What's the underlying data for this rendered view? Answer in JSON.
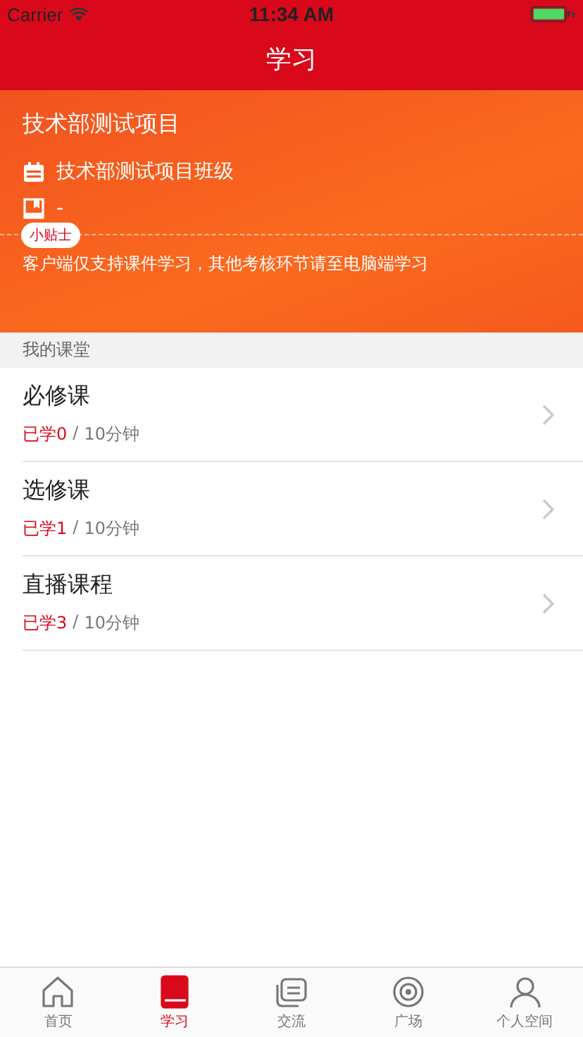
{
  "status_bar": {
    "carrier": "Carrier",
    "time": "11:34 AM"
  },
  "nav": {
    "title": "学习"
  },
  "project": {
    "title": "技术部测试项目",
    "class_name": "技术部测试项目班级",
    "book_info": "-",
    "tip_badge": "小贴士",
    "tip_text": "客户端仅支持课件学习，其他考核环节请至电脑端学习"
  },
  "section_title": "我的课堂",
  "courses": [
    {
      "title": "必修课",
      "learned": "已学0",
      "separator": "/",
      "duration": "10分钟"
    },
    {
      "title": "选修课",
      "learned": "已学1",
      "separator": "/",
      "duration": "10分钟"
    },
    {
      "title": "直播课程",
      "learned": "已学3",
      "separator": "/",
      "duration": "10分钟"
    }
  ],
  "tabs": [
    {
      "label": "首页",
      "selected": false
    },
    {
      "label": "学习",
      "selected": true
    },
    {
      "label": "交流",
      "selected": false
    },
    {
      "label": "广场",
      "selected": false
    },
    {
      "label": "个人空间",
      "selected": false
    }
  ]
}
